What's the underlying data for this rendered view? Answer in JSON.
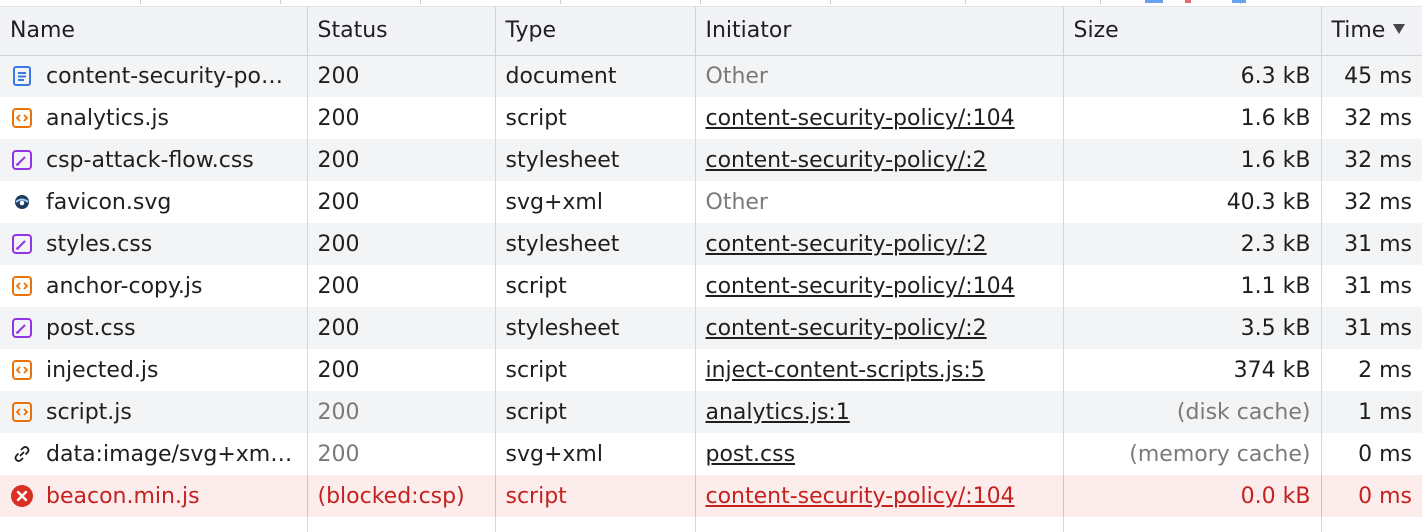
{
  "columns": {
    "name": "Name",
    "status": "Status",
    "type": "Type",
    "initiator": "Initiator",
    "size": "Size",
    "time": "Time"
  },
  "sort": {
    "column": "time",
    "direction": "descending"
  },
  "rows": [
    {
      "icon": "document-icon",
      "name": "content-security-po…",
      "status": "200",
      "status_muted": false,
      "type": "document",
      "initiator": "Other",
      "initiator_link": false,
      "size": "6.3 kB",
      "size_muted": false,
      "time": "45 ms",
      "error": false
    },
    {
      "icon": "script-icon",
      "name": "analytics.js",
      "status": "200",
      "status_muted": false,
      "type": "script",
      "initiator": "content-security-policy/:104",
      "initiator_link": true,
      "size": "1.6 kB",
      "size_muted": false,
      "time": "32 ms",
      "error": false
    },
    {
      "icon": "stylesheet-icon",
      "name": "csp-attack-flow.css",
      "status": "200",
      "status_muted": false,
      "type": "stylesheet",
      "initiator": "content-security-policy/:2",
      "initiator_link": true,
      "size": "1.6 kB",
      "size_muted": false,
      "time": "32 ms",
      "error": false
    },
    {
      "icon": "favicon-icon",
      "name": "favicon.svg",
      "status": "200",
      "status_muted": false,
      "type": "svg+xml",
      "initiator": "Other",
      "initiator_link": false,
      "size": "40.3 kB",
      "size_muted": false,
      "time": "32 ms",
      "error": false
    },
    {
      "icon": "stylesheet-icon",
      "name": "styles.css",
      "status": "200",
      "status_muted": false,
      "type": "stylesheet",
      "initiator": "content-security-policy/:2",
      "initiator_link": true,
      "size": "2.3 kB",
      "size_muted": false,
      "time": "31 ms",
      "error": false
    },
    {
      "icon": "script-icon",
      "name": "anchor-copy.js",
      "status": "200",
      "status_muted": false,
      "type": "script",
      "initiator": "content-security-policy/:104",
      "initiator_link": true,
      "size": "1.1 kB",
      "size_muted": false,
      "time": "31 ms",
      "error": false
    },
    {
      "icon": "stylesheet-icon",
      "name": "post.css",
      "status": "200",
      "status_muted": false,
      "type": "stylesheet",
      "initiator": "content-security-policy/:2",
      "initiator_link": true,
      "size": "3.5 kB",
      "size_muted": false,
      "time": "31 ms",
      "error": false
    },
    {
      "icon": "script-icon",
      "name": "injected.js",
      "status": "200",
      "status_muted": false,
      "type": "script",
      "initiator": "inject-content-scripts.js:5",
      "initiator_link": true,
      "size": "374 kB",
      "size_muted": false,
      "time": "2 ms",
      "error": false
    },
    {
      "icon": "script-icon",
      "name": "script.js",
      "status": "200",
      "status_muted": true,
      "type": "script",
      "initiator": "analytics.js:1",
      "initiator_link": true,
      "size": "(disk cache)",
      "size_muted": true,
      "time": "1 ms",
      "error": false
    },
    {
      "icon": "data-url-icon",
      "name": "data:image/svg+xml…",
      "status": "200",
      "status_muted": true,
      "type": "svg+xml",
      "initiator": "post.css",
      "initiator_link": true,
      "size": "(memory cache)",
      "size_muted": true,
      "time": "0 ms",
      "error": false
    },
    {
      "icon": "error-icon",
      "name": "beacon.min.js",
      "status": "(blocked:csp)",
      "status_muted": false,
      "type": "script",
      "initiator": "content-security-policy/:104",
      "initiator_link": true,
      "size": "0.0 kB",
      "size_muted": false,
      "time": "0 ms",
      "error": true
    }
  ],
  "colors": {
    "header_bg": "#f1f3f6",
    "row_alt_bg": "#f3f4f6",
    "error_bg": "#fcecec",
    "error_text": "#c5221f",
    "document_icon": "#3b78e7",
    "script_icon": "#e8710a",
    "stylesheet_icon": "#9334e6"
  }
}
